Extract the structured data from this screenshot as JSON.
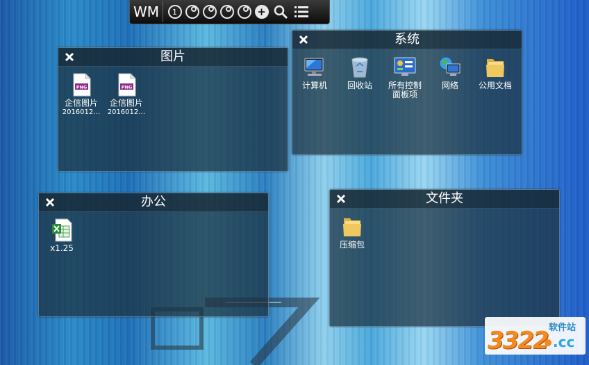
{
  "toolbar": {
    "brand": "WM",
    "page_number": "1",
    "buttons": [
      "page-1",
      "page-2",
      "page-3",
      "page-4",
      "page-5",
      "add",
      "search",
      "menu"
    ]
  },
  "fences": {
    "pictures": {
      "title": "图片",
      "items": [
        {
          "label": "企信图片",
          "sub": "2016012…",
          "icon": "png-file-icon"
        },
        {
          "label": "企信图片",
          "sub": "2016012…",
          "icon": "png-file-icon"
        }
      ]
    },
    "system": {
      "title": "系统",
      "items": [
        {
          "label": "计算机",
          "icon": "computer-icon"
        },
        {
          "label": "回收站",
          "icon": "recycle-bin-icon"
        },
        {
          "label": "所有控制面板项",
          "label_line1": "所有控制",
          "label_line2": "面板项",
          "icon": "control-panel-icon"
        },
        {
          "label": "网络",
          "icon": "network-icon"
        },
        {
          "label": "公用文档",
          "icon": "folder-icon"
        }
      ]
    },
    "office": {
      "title": "办公",
      "items": [
        {
          "label": "x1.25",
          "icon": "excel-file-icon"
        }
      ]
    },
    "folders": {
      "title": "文件夹",
      "items": [
        {
          "label": "压缩包",
          "icon": "folder-icon"
        }
      ]
    }
  },
  "watermark": {
    "number": "3322",
    "top_text": "软件站",
    "domain": ".cc"
  },
  "colors": {
    "png_badge": "#8a2a8a",
    "folder": "#f0c860",
    "excel": "#2a8a3a",
    "logo_orange": "#f28a1e",
    "logo_blue": "#2fa3e8"
  }
}
